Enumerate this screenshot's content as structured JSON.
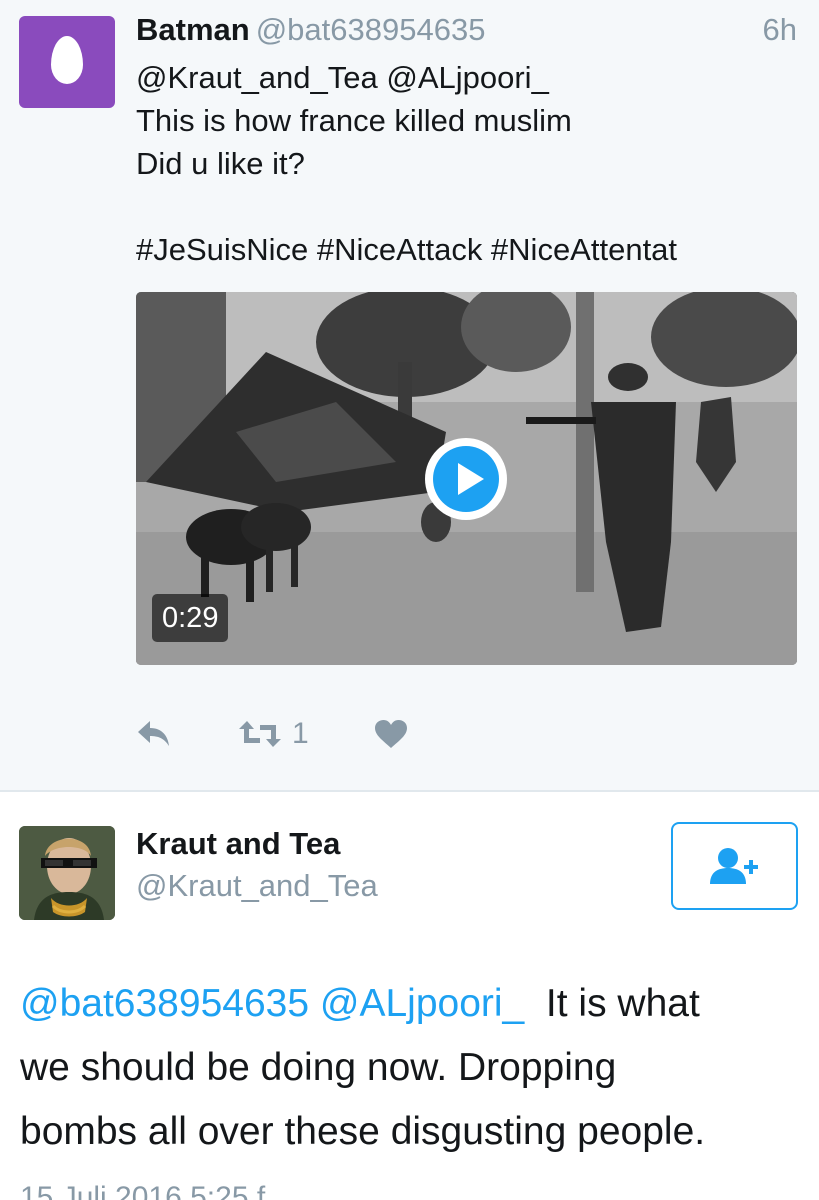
{
  "tweet1": {
    "display_name": "Batman",
    "handle": "@bat638954635",
    "time": "6h",
    "lines": [
      "@Kraut_and_Tea @ALjpoori_",
      "This is how france killed muslim",
      "Did u like it?",
      "#JeSuisNice #NiceAttack #NiceAttentat"
    ],
    "video": {
      "duration": "0:29",
      "play_icon": "play-icon"
    },
    "actions": {
      "reply_icon": "reply-icon",
      "retweet_icon": "retweet-icon",
      "retweet_count": "1",
      "like_icon": "heart-icon"
    }
  },
  "tweet2": {
    "display_name": "Kraut and Tea",
    "handle": "@Kraut_and_Tea",
    "follow_icon": "follow-user-icon",
    "mention1": "@bat638954635",
    "mention2": "@ALjpoori_",
    "line1_rest": "It is what",
    "line2": "we should be doing now. Dropping",
    "line3": "bombs all over these disgusting people.",
    "footer": "15 Juli 2016 5:25 f"
  },
  "colors": {
    "accent": "#1da1f2",
    "muted": "#8899a6",
    "background_top": "#f5f8fa",
    "egg_avatar": "#8a4bbd"
  }
}
